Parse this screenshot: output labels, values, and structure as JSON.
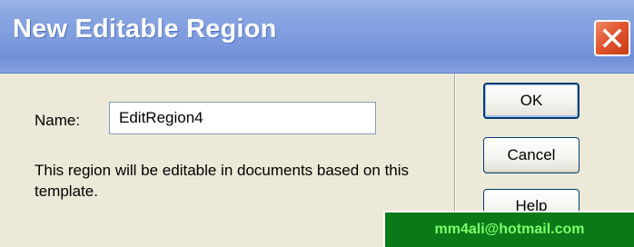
{
  "dialog": {
    "title": "New Editable Region",
    "close_icon": "close-x-icon",
    "name_label": "Name:",
    "name_value": "EditRegion4",
    "description": "This region will be editable in documents based on this template.",
    "buttons": {
      "ok": "OK",
      "cancel": "Cancel",
      "help": "Help"
    }
  },
  "watermark": {
    "text": "mm4ali@hotmail.com"
  },
  "colors": {
    "titlebar": "#7d9bdd",
    "dialog_bg": "#ece9d8",
    "close_button": "#e2552f",
    "watermark_bg": "#0a7a18",
    "watermark_text": "#7dff6a"
  }
}
